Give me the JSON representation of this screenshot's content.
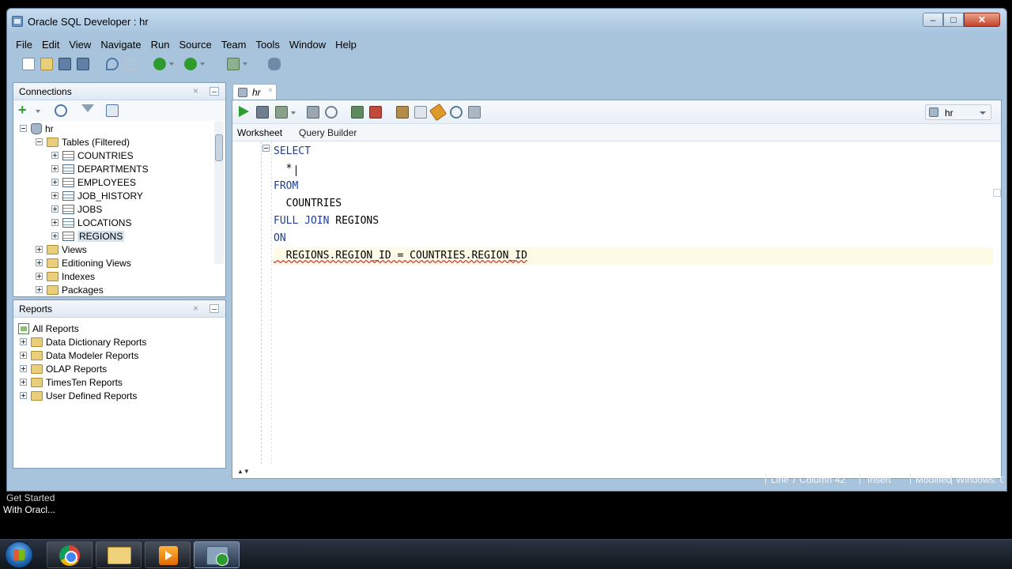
{
  "window": {
    "title": "Oracle SQL Developer : hr",
    "controls": {
      "minimize": "‒",
      "maximize": "□",
      "close": "✕"
    }
  },
  "menu": [
    "File",
    "Edit",
    "View",
    "Navigate",
    "Run",
    "Source",
    "Team",
    "Tools",
    "Window",
    "Help"
  ],
  "connections_panel": {
    "title": "Connections",
    "close": "×",
    "tree": {
      "root": "hr",
      "tables_node": "Tables (Filtered)",
      "tables": [
        "COUNTRIES",
        "DEPARTMENTS",
        "EMPLOYEES",
        "JOB_HISTORY",
        "JOBS",
        "LOCATIONS",
        "REGIONS"
      ],
      "selected_table": "REGIONS",
      "other_nodes": [
        "Views",
        "Editioning Views",
        "Indexes",
        "Packages"
      ]
    }
  },
  "reports_panel": {
    "title": "Reports",
    "close": "×",
    "root": "All Reports",
    "items": [
      "Data Dictionary Reports",
      "Data Modeler Reports",
      "OLAP Reports",
      "TimesTen Reports",
      "User Defined Reports"
    ]
  },
  "editor": {
    "tab_label": "hr",
    "tab_close": "×",
    "connection": "hr",
    "subtabs": {
      "worksheet": "Worksheet",
      "query_builder": "Query Builder"
    },
    "code_lines": [
      {
        "kw": "SELECT",
        "text": ""
      },
      {
        "kw": "",
        "text": "  *"
      },
      {
        "kw": "FROM",
        "text": ""
      },
      {
        "kw": "",
        "text": "  COUNTRIES"
      },
      {
        "kw": "FULL JOIN",
        "text": " REGIONS"
      },
      {
        "kw": "ON",
        "text": ""
      },
      {
        "kw": "",
        "text": "  REGIONS.REGION_ID = COUNTRIES.REGION_ID"
      }
    ],
    "current_line": 7
  },
  "statusbar": {
    "position": "Line 7 Column 42",
    "mode": "Insert",
    "state": "Modified",
    "encoding": "Windows: C"
  },
  "overlay_caption": {
    "line1": "Get Started",
    "line2": "With Oracl..."
  },
  "taskbar": {
    "apps": [
      "chrome-icon",
      "explorer-icon",
      "media-player-icon",
      "sql-developer-icon"
    ]
  },
  "colors": {
    "window_frame": "#a8c4dc",
    "keyword": "#1d3e9b",
    "current_line": "#fdfbe6",
    "run_green": "#2d9b2d"
  }
}
